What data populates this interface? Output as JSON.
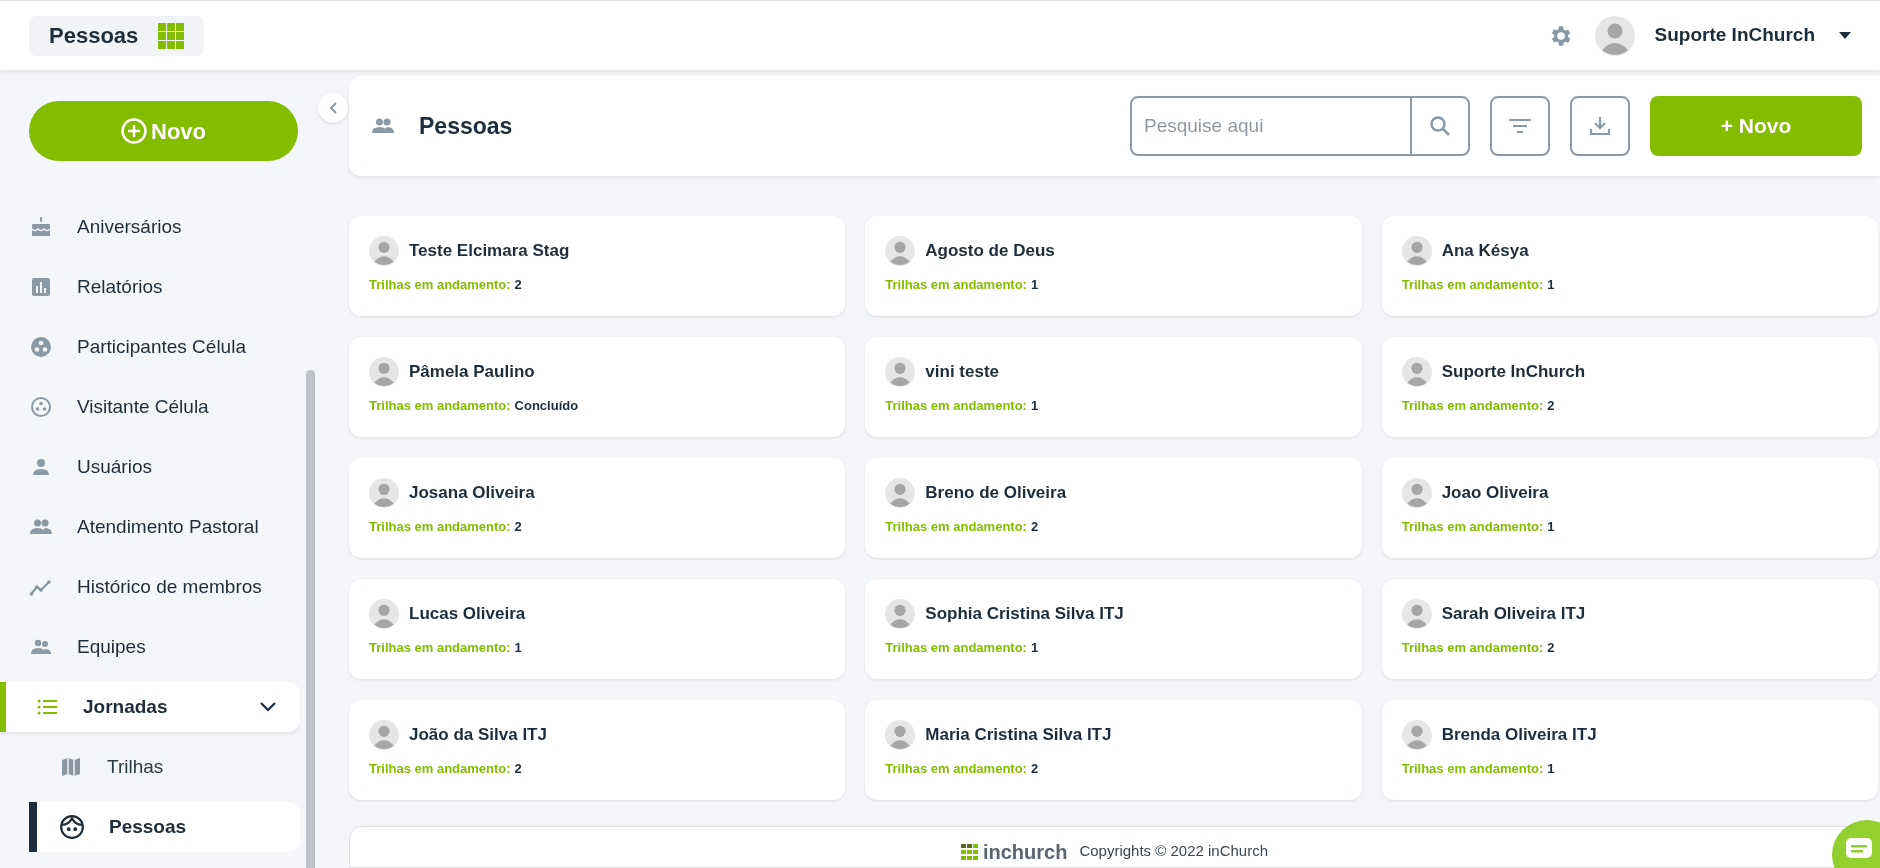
{
  "topbar": {
    "title": "Pessoas",
    "user": {
      "name": "Suporte InChurch"
    }
  },
  "sidebar": {
    "new_button": "Novo",
    "items": [
      {
        "label": "Aniversários",
        "kind": "link",
        "selected": false
      },
      {
        "label": "Relatórios",
        "kind": "link",
        "selected": false
      },
      {
        "label": "Participantes Célula",
        "kind": "link",
        "selected": false
      },
      {
        "label": "Visitante Célula",
        "kind": "link",
        "selected": false
      },
      {
        "label": "Usuários",
        "kind": "link",
        "selected": false
      },
      {
        "label": "Atendimento Pastoral",
        "kind": "link",
        "selected": false
      },
      {
        "label": "Histórico de membros",
        "kind": "link",
        "selected": false
      },
      {
        "label": "Equipes",
        "kind": "link",
        "selected": false
      },
      {
        "label": "Jornadas",
        "kind": "group",
        "selected": true,
        "expanded": true,
        "children": [
          {
            "label": "Trilhas",
            "selected": false
          },
          {
            "label": "Pessoas",
            "selected": true
          }
        ]
      }
    ]
  },
  "page_header": {
    "title": "Pessoas",
    "search": {
      "placeholder": "Pesquise aqui"
    },
    "new_button": "+ Novo"
  },
  "people": [
    {
      "name": "Teste Elcimara Stag",
      "label": "Trilhas em andamento:",
      "value": "2"
    },
    {
      "name": "Agosto de Deus",
      "label": "Trilhas em andamento:",
      "value": "1"
    },
    {
      "name": "Ana Késya",
      "label": "Trilhas em andamento:",
      "value": "1"
    },
    {
      "name": "Pâmela Paulino",
      "label": "Trilhas em andamento:",
      "value": "Concluído"
    },
    {
      "name": "vini teste",
      "label": "Trilhas em andamento:",
      "value": "1"
    },
    {
      "name": "Suporte InChurch",
      "label": "Trilhas em andamento:",
      "value": "2"
    },
    {
      "name": "Josana Oliveira",
      "label": "Trilhas em andamento:",
      "value": "2"
    },
    {
      "name": "Breno de Oliveira",
      "label": "Trilhas em andamento:",
      "value": "2"
    },
    {
      "name": "Joao Oliveira",
      "label": "Trilhas em andamento:",
      "value": "1"
    },
    {
      "name": "Lucas Oliveira",
      "label": "Trilhas em andamento:",
      "value": "1"
    },
    {
      "name": "Sophia Cristina Silva ITJ",
      "label": "Trilhas em andamento:",
      "value": "1"
    },
    {
      "name": "Sarah Oliveira ITJ",
      "label": "Trilhas em andamento:",
      "value": "2"
    },
    {
      "name": "João da Silva ITJ",
      "label": "Trilhas em andamento:",
      "value": "2"
    },
    {
      "name": "Maria Cristina Silva ITJ",
      "label": "Trilhas em andamento:",
      "value": "2"
    },
    {
      "name": "Brenda Oliveira ITJ",
      "label": "Trilhas em andamento:",
      "value": "1"
    }
  ],
  "footer": {
    "logo": "inchurch",
    "copyright": "Copyrights © 2022 inChurch"
  }
}
